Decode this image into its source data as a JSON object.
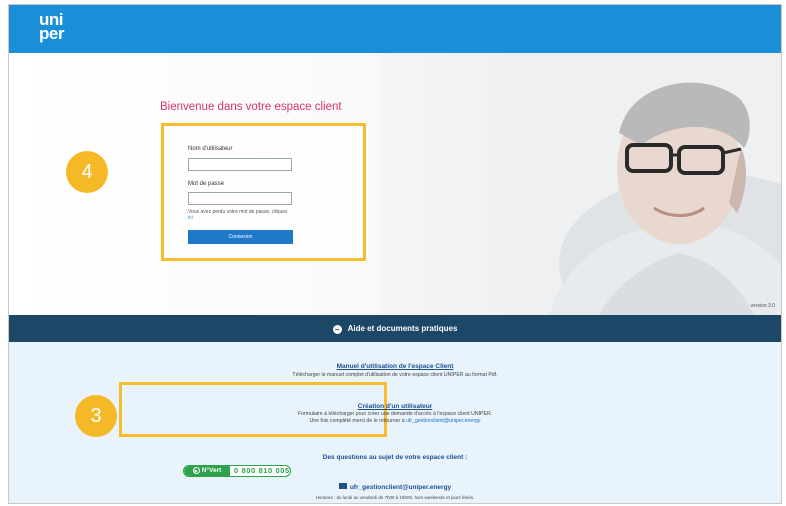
{
  "header": {
    "logo_line1": "uni",
    "logo_line2": "per"
  },
  "hero": {
    "welcome": "Bienvenue dans votre espace client",
    "username_label": "Nom d'utilisateur",
    "username_value": "",
    "password_label": "Mot de passe",
    "password_value": "",
    "forgot_text": "Vous avez perdu votre mot de passe, cliquez",
    "forgot_link": "ici",
    "login_button": "Connexion",
    "version": "version 3.0"
  },
  "steps": {
    "step4": "4",
    "step3": "3"
  },
  "help_bar": {
    "label": "Aide et documents pratiques"
  },
  "bottom": {
    "manual_title": "Manuel d'utilisation de l'espace Client",
    "manual_desc": "Télécharger le manuel complet d'utilisation de votre espace client UNIPER au format Pdf.",
    "creation_title": "Création d'un utilisateur",
    "creation_desc1": "Formulaire à télécharger pour créer une demande d'accès à l'espace client UNIPER.",
    "creation_desc2_prefix": "Une fois complété merci de le retourner à ",
    "creation_email": "ufr_gestionclient@uniper.energy",
    "questions": "Des questions au sujet de votre espace client :",
    "vert_label": "N°Vert",
    "phone": "0 800 810 005",
    "email": "ufr_gestionclient@uniper.energy",
    "hours": "Horaires : du lundi au vendredi de 7h00 à 18h00, hors weekends et jours fériés."
  },
  "colors": {
    "header_blue": "#1a8fd8",
    "welcome_pink": "#d4356a",
    "highlight_yellow": "#f7bd2a",
    "help_bar_navy": "#1d4767",
    "green": "#2da24a"
  }
}
